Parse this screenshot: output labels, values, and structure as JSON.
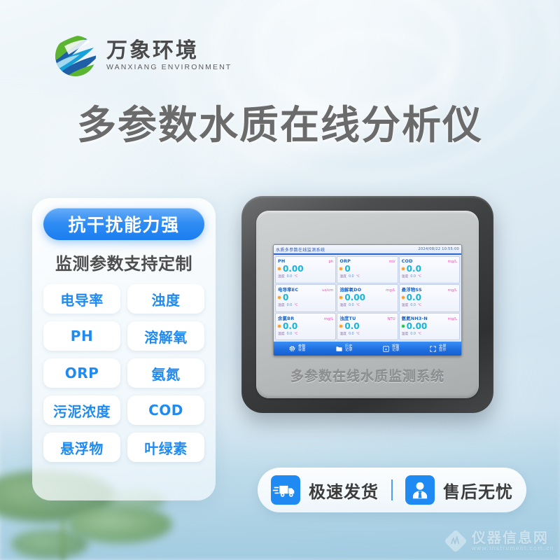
{
  "brand": {
    "name_cn": "万象环境",
    "name_en": "WANXIANG ENVIRONMENT",
    "logo_icon": "globe-swoosh-logo",
    "colors": {
      "green": "#6ab42e",
      "blue": "#1a4f9c",
      "cyan": "#18a0d8"
    }
  },
  "headline": "多参数水质在线分析仪",
  "features": {
    "highlight": "抗干扰能力强",
    "subtitle": "监测参数支持定制",
    "chips": [
      "电导率",
      "浊度",
      "PH",
      "溶解氧",
      "ORP",
      "氨氮",
      "污泥浓度",
      "COD",
      "悬浮物",
      "叶绿素"
    ],
    "accent_color": "#1f8bf2"
  },
  "device": {
    "caption": "多参数在线水质监测系统",
    "bezel_color": "#3c3e3f",
    "panel_color": "#c2c5c5",
    "screen": {
      "title": "水质多参数在线监测系统",
      "clock": "2024/08/22 10:55:00",
      "accent_color": "#2a66d8",
      "value_color": "#16b6d8",
      "unit_color": "#e854b8",
      "temp_label": "温度",
      "temp_value": "0.0",
      "temp_unit": "℃",
      "cells": [
        {
          "name": "PH",
          "unit": "ph",
          "value": "0.00",
          "led": "on"
        },
        {
          "name": "ORP",
          "unit": "mV",
          "value": "0",
          "led": "on"
        },
        {
          "name": "COD",
          "unit": "mg/L",
          "value": "0.0",
          "led": "on"
        },
        {
          "name": "电导率EC",
          "unit": "us/cm",
          "value": "0",
          "led": "on"
        },
        {
          "name": "溶解氧DO",
          "unit": "mg/L",
          "value": "0.00",
          "led": "on"
        },
        {
          "name": "悬浮物SS",
          "unit": "mg/L",
          "value": "0.0",
          "led": "on"
        },
        {
          "name": "余氯BR",
          "unit": "mg/L",
          "value": "0.0",
          "led": "on"
        },
        {
          "name": "浊度TU",
          "unit": "NTU",
          "value": "0.0",
          "led": "on"
        },
        {
          "name": "氨氮NH3-N",
          "unit": "mg/L",
          "value": "0.00",
          "led": "ok"
        }
      ],
      "nav": [
        {
          "icon": "gear-icon",
          "line1": "参数",
          "line2": "设置"
        },
        {
          "icon": "folder-icon",
          "line1": "历史",
          "line2": "记录"
        },
        {
          "icon": "alarm-icon",
          "line1": "报警",
          "line2": "记录"
        },
        {
          "icon": "expand-icon",
          "line1": "全屏",
          "line2": "显示"
        }
      ]
    }
  },
  "services": [
    {
      "icon": "delivery-truck-icon",
      "label": "极速发货"
    },
    {
      "icon": "support-agent-icon",
      "label": "售后无忧"
    }
  ],
  "watermark": {
    "name_cn": "仪器信息网",
    "name_en": "www.instrument.com.cn",
    "icon": "instrument-net-logo"
  }
}
